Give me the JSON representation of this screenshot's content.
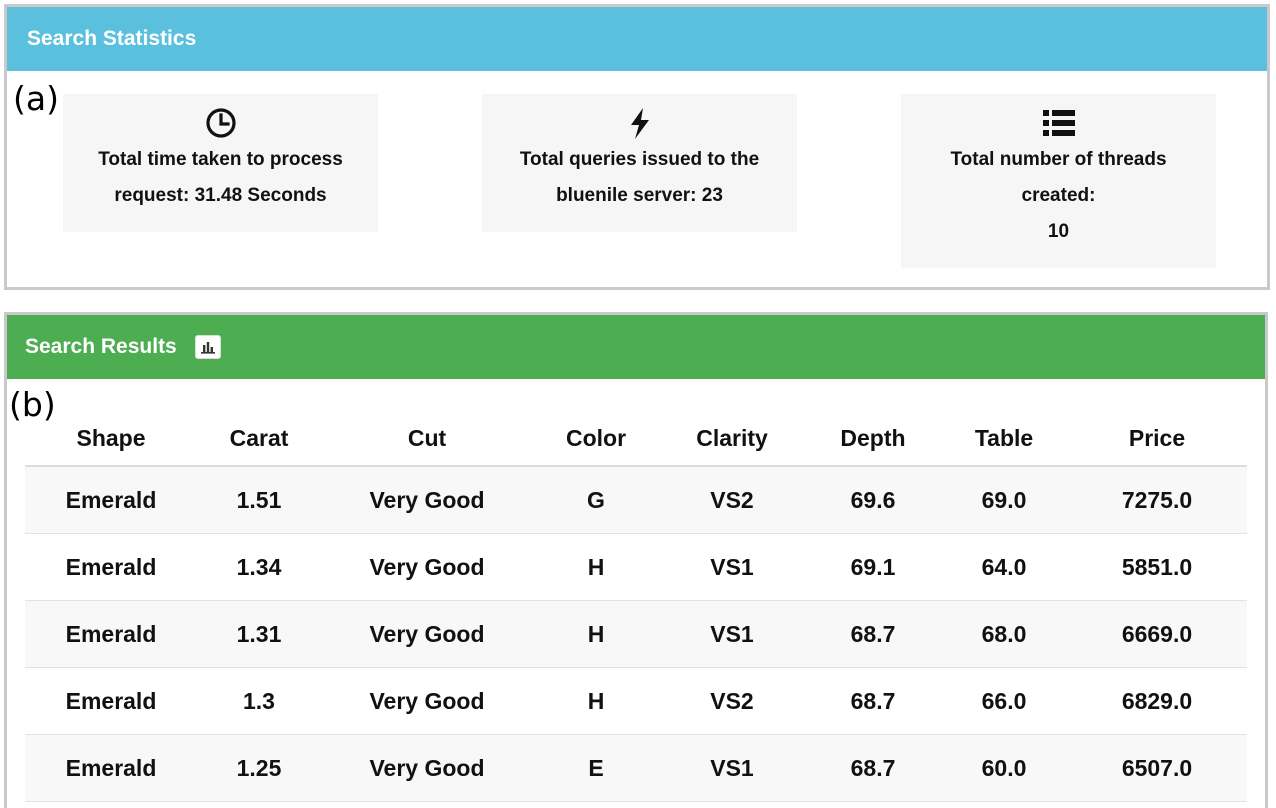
{
  "stats": {
    "header": "Search Statistics",
    "letter": "(a)",
    "cards": [
      {
        "icon": "clock-icon",
        "line1": "Total time taken to process",
        "line2": "request: 31.48 Seconds"
      },
      {
        "icon": "bolt-icon",
        "line1": "Total queries issued to the",
        "line2": "bluenile server: 23"
      },
      {
        "icon": "list-icon",
        "line1": "Total number of threads",
        "line2": "created:",
        "line3": "10"
      }
    ]
  },
  "results": {
    "header": "Search Results",
    "letter": "(b)",
    "chart_icon": "bar-chart-icon",
    "columns": [
      "Shape",
      "Carat",
      "Cut",
      "Color",
      "Clarity",
      "Depth",
      "Table",
      "Price"
    ],
    "rows": [
      [
        "Emerald",
        "1.51",
        "Very Good",
        "G",
        "VS2",
        "69.6",
        "69.0",
        "7275.0"
      ],
      [
        "Emerald",
        "1.34",
        "Very Good",
        "H",
        "VS1",
        "69.1",
        "64.0",
        "5851.0"
      ],
      [
        "Emerald",
        "1.31",
        "Very Good",
        "H",
        "VS1",
        "68.7",
        "68.0",
        "6669.0"
      ],
      [
        "Emerald",
        "1.3",
        "Very Good",
        "H",
        "VS2",
        "68.7",
        "66.0",
        "6829.0"
      ],
      [
        "Emerald",
        "1.25",
        "Very Good",
        "E",
        "VS1",
        "68.7",
        "60.0",
        "6507.0"
      ]
    ]
  },
  "colors": {
    "stats_header": "#5bc0de",
    "results_header": "#4cae50"
  }
}
